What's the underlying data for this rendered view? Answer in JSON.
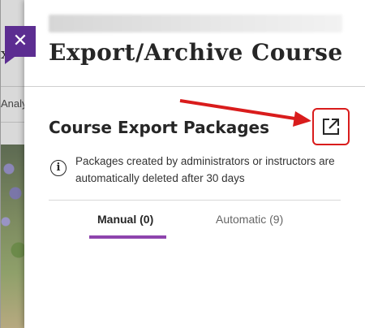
{
  "dialog": {
    "close_symbol": "✕",
    "title": "Export/Archive Course"
  },
  "background": {
    "fragment_top": "x",
    "fragment_nav": "Analy"
  },
  "section": {
    "title": "Course Export Packages",
    "export_icon": "external-link-icon"
  },
  "info": {
    "icon": "i",
    "text": "Packages created by administrators or instructors are automatically deleted after 30 days"
  },
  "tabs": [
    {
      "label": "Manual (0)",
      "active": true
    },
    {
      "label": "Automatic (9)",
      "active": false
    }
  ],
  "colors": {
    "accent": "#5c2d91",
    "tab_underline": "#8e44ad",
    "annotation": "#d91c1c"
  }
}
